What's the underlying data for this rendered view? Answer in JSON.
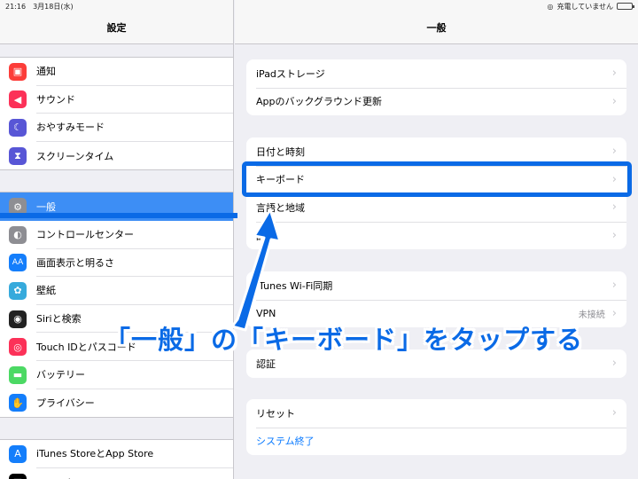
{
  "status_bar": {
    "time": "21:16",
    "date": "3月18日(水)",
    "charging": "充電していません"
  },
  "sidebar": {
    "title": "設定",
    "groups": [
      {
        "items": [
          {
            "label": "通知",
            "icon": "notification-icon",
            "color": "#fc3d39"
          },
          {
            "label": "サウンド",
            "icon": "speaker-icon",
            "color": "#fc3158"
          },
          {
            "label": "おやすみモード",
            "icon": "moon-icon",
            "color": "#5856d6"
          },
          {
            "label": "スクリーンタイム",
            "icon": "hourglass-icon",
            "color": "#5856d6"
          }
        ]
      },
      {
        "items": [
          {
            "label": "一般",
            "icon": "gear-icon",
            "color": "#8e8e93"
          },
          {
            "label": "コントロールセンター",
            "icon": "toggle-icon",
            "color": "#8e8e93"
          },
          {
            "label": "画面表示と明るさ",
            "icon": "text-size-icon",
            "color": "#147efb"
          },
          {
            "label": "壁紙",
            "icon": "flower-icon",
            "color": "#36aadc"
          },
          {
            "label": "Siriと検索",
            "icon": "siri-icon",
            "color": "#222"
          },
          {
            "label": "Touch IDとパスコード",
            "icon": "fingerprint-icon",
            "color": "#fc3158"
          },
          {
            "label": "バッテリー",
            "icon": "battery-icon",
            "color": "#4cd964"
          },
          {
            "label": "プライバシー",
            "icon": "hand-icon",
            "color": "#147efb"
          }
        ]
      },
      {
        "items": [
          {
            "label": "iTunes StoreとApp Store",
            "icon": "app-store-icon",
            "color": "#147efb"
          },
          {
            "label": "WalletとApple Pay",
            "icon": "wallet-icon",
            "color": "#000"
          }
        ]
      }
    ]
  },
  "main": {
    "title": "一般",
    "groups": [
      {
        "rows": [
          {
            "label": "iPadストレージ"
          },
          {
            "label": "Appのバックグラウンド更新"
          }
        ]
      },
      {
        "rows": [
          {
            "label": "日付と時刻"
          },
          {
            "label": "キーボード"
          },
          {
            "label": "言語と地域"
          },
          {
            "label": "辞書"
          }
        ]
      },
      {
        "rows": [
          {
            "label": "iTunes Wi-Fi同期"
          },
          {
            "label": "VPN",
            "value": "未接続"
          }
        ]
      },
      {
        "rows": [
          {
            "label": "認証"
          }
        ]
      },
      {
        "rows": [
          {
            "label": "リセット"
          },
          {
            "label": "システム終了",
            "link": true
          }
        ]
      }
    ]
  },
  "annotation": {
    "text": "「一般」の「キーボード」をタップする",
    "color": "#0a6ae6"
  }
}
